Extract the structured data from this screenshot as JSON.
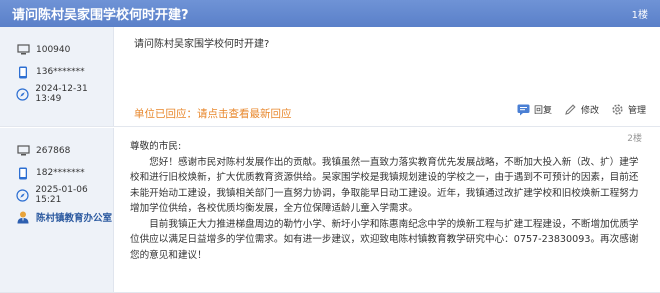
{
  "thread": {
    "title": "请问陈村吴家围学校何时开建?",
    "floor_label": "1楼"
  },
  "post1": {
    "user_id": "100940",
    "phone": "136*******",
    "datetime": "2024-12-31 13:49",
    "question": "请问陈村吴家围学校何时开建?",
    "reply_prefix": "单位已回应：",
    "reply_link": "请点击查看最新回应",
    "actions": {
      "reply": "回复",
      "edit": "修改",
      "manage": "管理"
    }
  },
  "post2": {
    "floor_label": "2楼",
    "user_id": "267868",
    "phone": "182*******",
    "datetime": "2025-01-06 15:21",
    "org": "陈村镇教育办公室",
    "greeting": "尊敬的市民:",
    "paragraph1": "您好！感谢市民对陈村发展作出的贡献。我镇虽然一直致力落实教育优先发展战略，不断加大投入新（改、扩）建学校和进行旧校焕新，扩大优质教育资源供给。吴家围学校是我镇规划建设的学校之一，由于遇到不可预计的因素，目前还未能开始动工建设，我镇相关部门一直努力协调，争取能早日动工建设。近年，我镇通过改扩建学校和旧校焕新工程努力增加学位供给，各校优质均衡发展，全方位保障适龄儿童入学需求。",
    "paragraph2": "目前我镇正大力推进梯盘周边的勒竹小学、新圩小学和陈惠南纪念中学的焕新工程与扩建工程建设，不断增加优质学位供应以满足日益增多的学位需求。如有进一步建议，欢迎致电陈村镇教育教学研究中心：0757-23830093。再次感谢您的意见和建议！"
  }
}
